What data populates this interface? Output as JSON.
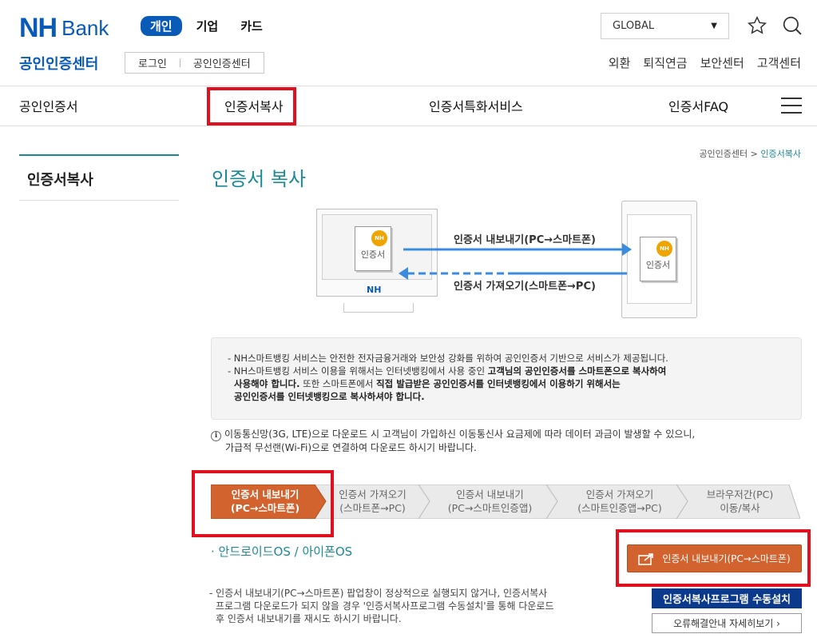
{
  "header": {
    "logo_nh": "NH",
    "logo_bank": "Bank",
    "segments": [
      "개인",
      "기업",
      "카드"
    ],
    "global_select": "GLOBAL",
    "section_title": "공인인증센터",
    "sub_tabs": [
      "로그인",
      "공인인증센터"
    ],
    "util_links": [
      "외환",
      "퇴직연금",
      "보안센터",
      "고객센터"
    ]
  },
  "mainmenu": [
    "공인인증서",
    "인증서복사",
    "인증서특화서비스",
    "인증서FAQ"
  ],
  "sidebar": {
    "title": "인증서복사"
  },
  "breadcrumb": {
    "root": "공인인증센터",
    "sep": ">",
    "current": "인증서복사"
  },
  "page_title": "인증서 복사",
  "diagram": {
    "monitor_brand": "NH",
    "cert_label": "인증서",
    "seal": "NH",
    "export_label": "인증서 내보내기(PC→스마트폰)",
    "import_label": "인증서 가져오기(스마트폰→PC)"
  },
  "info": {
    "line1": "- NH스마트뱅킹 서비스는 안전한 전자금융거래와 보안성 강화를 위하여 공인인증서 기반으로 서비스가 제공됩니다.",
    "line2a": "- NH스마트뱅킹 서비스 이용을 위해서는 인터넷뱅킹에서 사용 중인 ",
    "line2b": "고객님의 공인인증서를 스마트폰으로 복사하여",
    "line3": "사용해야 합니다.",
    "line3b": " 또한 스마트폰에서 ",
    "line3c": "직접 발급받은 공인인증서를 인터넷뱅킹에서 이용하기 위해서는",
    "line4": "공인인증서를 인터넷뱅킹으로 복사하셔야 합니다."
  },
  "note": {
    "icon": "ℹ",
    "line1": "이동통신망(3G, LTE)으로 다운로드 시 고객님이 가입하신 이동통신사 요금제에 따라 데이터 과금이 발생할 수 있으니,",
    "line2": "가급적 무선랜(Wi-Fi)으로 연결하여 다운로드 하시기 바랍니다."
  },
  "steps": [
    {
      "l1": "인증서 내보내기",
      "l2": "(PC→스마트폰)",
      "active": true
    },
    {
      "l1": "인증서 가져오기",
      "l2": "(스마트폰→PC)",
      "active": false
    },
    {
      "l1": "인증서 내보내기",
      "l2": "(PC→스마트인증앱)",
      "active": false
    },
    {
      "l1": "인증서 가져오기",
      "l2": "(스마트인증앱→PC)",
      "active": false
    },
    {
      "l1": "브라우저간(PC)",
      "l2": "이동/복사",
      "active": false
    }
  ],
  "os_title": "· 안드로이드OS / 아이폰OS",
  "export_button": "인증서 내보내기(PC→스마트폰)",
  "desc": {
    "line1": "- 인증서 내보내기(PC→스마트폰) 팝업창이 정상적으로 실행되지 않거나, 인증서복사",
    "line2": "프로그램 다운로드가 되지 않을 경우 '인증서복사프로그램 수동설치'를 통해 다운로드",
    "line3": "후 인증서 내보내기를 재시도 하시기 바랍니다."
  },
  "install_button": "인증서복사프로그램 수동설치",
  "guide_button": "오류해결안내 자세히보기 ›",
  "colors": {
    "brand": "#0a5bb8",
    "teal": "#1a8a96",
    "accent_orange": "#d2622e",
    "highlight_red": "#e0101e"
  }
}
